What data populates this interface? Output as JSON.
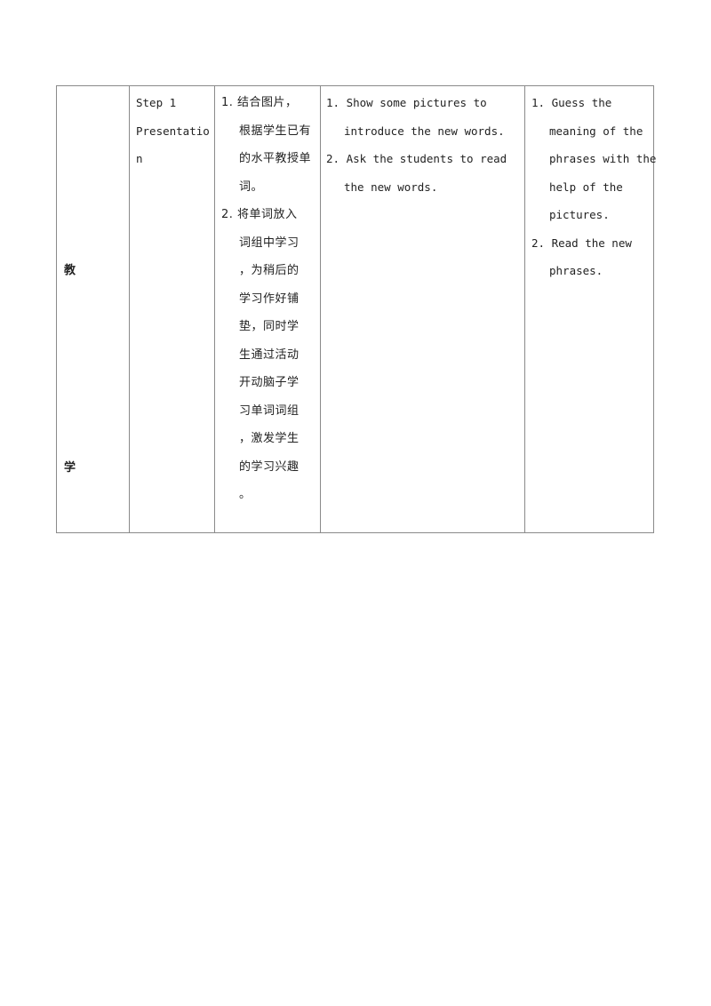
{
  "table": {
    "side_label": {
      "top": "教",
      "bottom": "学"
    },
    "step": [
      "Step 1",
      "Presentatio",
      "n"
    ],
    "purpose": [
      {
        "text": "1. 结合图片，",
        "indent": false
      },
      {
        "text": "根据学生已有",
        "indent": true
      },
      {
        "text": "的水平教授单",
        "indent": true
      },
      {
        "text": "词。",
        "indent": true
      },
      {
        "text": "2. 将单词放入",
        "indent": false
      },
      {
        "text": "词组中学习",
        "indent": true
      },
      {
        "text": "，为稍后的",
        "indent": true
      },
      {
        "text": "学习作好铺",
        "indent": true
      },
      {
        "text": "垫，同时学",
        "indent": true
      },
      {
        "text": "生通过活动",
        "indent": true
      },
      {
        "text": "开动脑子学",
        "indent": true
      },
      {
        "text": "习单词词组",
        "indent": true
      },
      {
        "text": "，激发学生",
        "indent": true
      },
      {
        "text": "的学习兴趣",
        "indent": true
      },
      {
        "text": "。",
        "indent": true
      }
    ],
    "teacher": [
      {
        "text": "1. Show some pictures to",
        "indent": false
      },
      {
        "text": "introduce the new words.",
        "indent": true
      },
      {
        "text": "2. Ask the students to read",
        "indent": false
      },
      {
        "text": "the new words.",
        "indent": true
      }
    ],
    "student": [
      {
        "text": "1. Guess the",
        "indent": false
      },
      {
        "text": "meaning of the",
        "indent": true
      },
      {
        "text": "phrases with the",
        "indent": true
      },
      {
        "text": "help of the",
        "indent": true
      },
      {
        "text": "pictures.",
        "indent": true
      },
      {
        "text": "2. Read the new",
        "indent": false
      },
      {
        "text": "phrases.",
        "indent": true
      }
    ]
  }
}
